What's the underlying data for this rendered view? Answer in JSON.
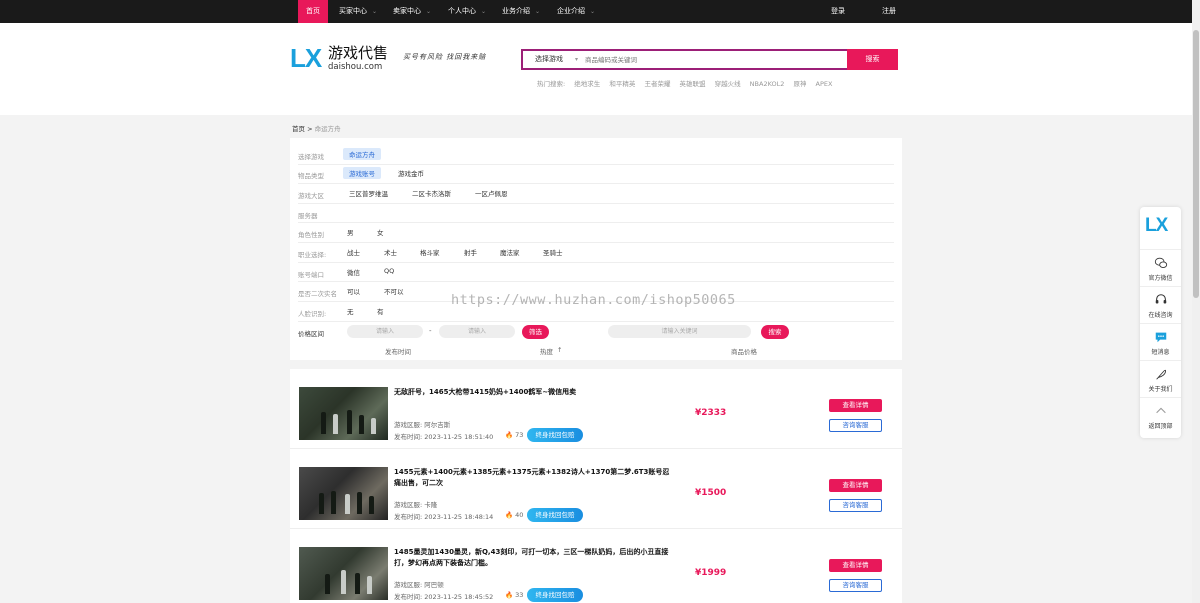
{
  "nav": {
    "home": "首页",
    "buyer": "买家中心",
    "seller": "卖家中心",
    "personal": "个人中心",
    "business": "业务介绍",
    "enterprise": "企业介绍",
    "login": "登录",
    "register": "注册"
  },
  "brand": {
    "mark": "LX",
    "title": "游戏代售",
    "domain": "daishou.com",
    "slogan": "买号有风险 找回我来赔"
  },
  "search": {
    "select_label": "选择游戏",
    "placeholder": "商品编码或关键词",
    "button": "搜索"
  },
  "hot_searches": {
    "label": "热门搜索:",
    "items": [
      "绝地求生",
      "和平精英",
      "王者荣耀",
      "英雄联盟",
      "穿越火线",
      "NBA2KOL2",
      "原神",
      "APEX"
    ]
  },
  "breadcrumb": {
    "home": "首页",
    "separator": ">",
    "current": "命运方舟"
  },
  "filters": {
    "game": {
      "label": "选择游戏",
      "options": [
        "命运方舟"
      ]
    },
    "item_type": {
      "label": "物品类型",
      "options": [
        "游戏账号",
        "游戏金币"
      ]
    },
    "region": {
      "label": "游戏大区",
      "options": [
        "三区普罗维温",
        "二区卡杰洛斯",
        "一区卢佩恩"
      ]
    },
    "server": {
      "label": "服务器"
    },
    "gender": {
      "label": "角色性别",
      "options": [
        "男",
        "女"
      ]
    },
    "class": {
      "label": "职业选择:",
      "options": [
        "战士",
        "术士",
        "格斗家",
        "射手",
        "魔法家",
        "圣骑士"
      ]
    },
    "account_port": {
      "label": "账号端口",
      "options": [
        "微信",
        "QQ"
      ]
    },
    "secondary_auth": {
      "label": "是否二次实名",
      "options": [
        "可以",
        "不可以"
      ]
    },
    "face_recognition": {
      "label": "人脸识别:",
      "options": [
        "无",
        "有"
      ]
    },
    "price": {
      "label": "价格区间",
      "min_placeholder": "请输入",
      "dash": "-",
      "max_placeholder": "请输入",
      "filter_button": "筛选",
      "keyword_placeholder": "请输入关键词",
      "search_button": "搜索"
    }
  },
  "sort": {
    "time": "发布时间",
    "heat": "热度",
    "heat_arrow": "↑",
    "price": "商品价格"
  },
  "watermark": "https://www.huzhan.com/ishop50065",
  "listings": [
    {
      "title": "无敌肝号，1465大枪带1415奶妈+1400鹤军~微信甩卖",
      "region_label": "游戏区服:",
      "region": "阿尔吉斯",
      "time_label": "发布时间:",
      "time": "2023-11-25 18:51:40",
      "heat": "73",
      "contact": "终身找回包赔",
      "price": "¥2333",
      "detail": "查看详情",
      "consult": "咨询客服"
    },
    {
      "title": "1455元素+1400元素+1385元素+1375元素+1382诗人+1370第二梦.6T3账号忍痛出售，可二次",
      "region_label": "游戏区服:",
      "region": "卡隆",
      "time_label": "发布时间:",
      "time": "2023-11-25 18:48:14",
      "heat": "40",
      "contact": "终身找回包赔",
      "price": "¥1500",
      "detail": "查看详情",
      "consult": "咨询客服"
    },
    {
      "title": "1485墨灵加1430墨灵，新Q,43刻印，可打一切本，三区一梯队奶妈，后出的小丑直接打，梦幻再点两下装备达门槛。",
      "region_label": "游戏区服:",
      "region": "阿巴顿",
      "time_label": "发布时间:",
      "time": "2023-11-25 18:45:52",
      "heat": "33",
      "contact": "终身找回包赔",
      "price": "¥1999",
      "detail": "查看详情",
      "consult": "咨询客服"
    }
  ],
  "sidebar_float": {
    "mark": "LX",
    "items": [
      "官方微信",
      "在线咨询",
      "短消息",
      "关于我们",
      "返回顶部"
    ]
  },
  "colors": {
    "accent": "#e8185a",
    "brand_blue": "#1aa0dc",
    "nav_bg": "#1a1a1a",
    "search_border": "#9c1f77"
  }
}
